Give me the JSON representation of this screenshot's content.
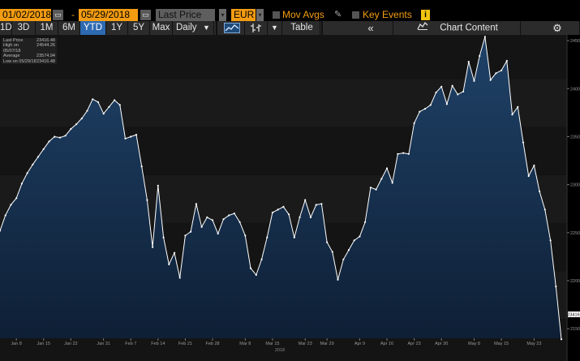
{
  "toolbar_top": {
    "start_date": "01/02/2018",
    "dash": "-",
    "end_date": "05/29/2018",
    "price_field": "Last Price",
    "currency": "EUR",
    "mov_avgs_label": "Mov Avgs",
    "key_events_label": "Key Events",
    "info_icon_text": "i",
    "calendar_icon": "calendar-icon",
    "caret_icon": "chevron-down-icon"
  },
  "toolbar_periods": {
    "items": [
      "1D",
      "3D",
      "1M",
      "6M",
      "YTD",
      "1Y",
      "5Y",
      "Max"
    ],
    "active": "YTD",
    "frequency": "Daily",
    "frequency_caret": "▼",
    "mountain_icon": "mountain-chart-icon",
    "bar_icon": "ohlc-bar-icon",
    "chart_type_caret": "▼",
    "table_label": "Table",
    "collapse_label": "«",
    "chart_content_label": "Chart Content",
    "chart_content_icon": "chart-content-icon",
    "settings_icon": "gear-icon"
  },
  "legend": {
    "rows": [
      {
        "label": "Last Price",
        "value": "23416.48"
      },
      {
        "label": "High on 05/07/18",
        "value": "24544.26"
      },
      {
        "label": "Average",
        "value": "23574.94"
      },
      {
        "label": "Low on 05/29/18",
        "value": "23416.48"
      }
    ]
  },
  "colors": {
    "accent_orange": "#f39c12",
    "active_blue": "#2e6ab1",
    "area_top": "#1c3a5c",
    "area_bottom": "#0f2238",
    "line": "#ffffff",
    "background": "#000000"
  },
  "chart_data": {
    "type": "area",
    "xlabel": "2018",
    "x_ticks": [
      "Jan 8",
      "Jan 15",
      "Jan 22",
      "Jan 31",
      "Feb 7",
      "Feb 14",
      "Feb 21",
      "Feb 28",
      "Mar 8",
      "Mar 15",
      "Mar 23",
      "Mar 29",
      "Apr 9",
      "Apr 16",
      "Apr 23",
      "Apr 30",
      "May 8",
      "May 15",
      "May 23"
    ],
    "y_ticks": [
      "24500",
      "24000",
      "23500",
      "23000",
      "22500",
      "22000",
      "21500"
    ],
    "ylim": [
      21400,
      24560
    ],
    "last_value_label": "23416",
    "grid": false,
    "values": [
      22520,
      22680,
      22790,
      22860,
      23010,
      23120,
      23210,
      23290,
      23370,
      23450,
      23500,
      23490,
      23510,
      23580,
      23630,
      23690,
      23770,
      23890,
      23860,
      23740,
      23810,
      23880,
      23830,
      23480,
      23500,
      23520,
      23190,
      22840,
      22350,
      22990,
      22450,
      22170,
      22290,
      22030,
      22470,
      22510,
      22800,
      22560,
      22660,
      22630,
      22490,
      22640,
      22680,
      22700,
      22610,
      22470,
      22130,
      22060,
      22220,
      22450,
      22710,
      22740,
      22770,
      22690,
      22450,
      22660,
      22840,
      22660,
      22790,
      22800,
      22400,
      22300,
      22010,
      22220,
      22320,
      22420,
      22460,
      22610,
      22970,
      22950,
      23060,
      23170,
      23020,
      23320,
      23330,
      23320,
      23640,
      23760,
      23790,
      23830,
      23960,
      24020,
      23840,
      24030,
      23940,
      23970,
      24280,
      24080,
      24340,
      24540,
      24090,
      24160,
      24190,
      24290,
      23730,
      23810,
      23440,
      23090,
      23200,
      22930,
      22740,
      22420,
      21940,
      21390
    ]
  }
}
